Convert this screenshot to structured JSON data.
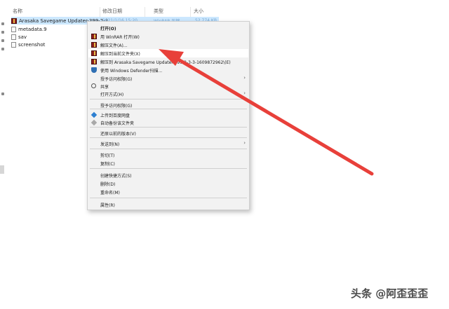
{
  "explorer": {
    "columns": [
      "名称",
      "修改日期",
      "类型",
      "大小"
    ],
    "files": [
      {
        "name": "Arasaka Savegame Updater-399-2-3",
        "date": "2021/1/16 15:20",
        "type": "WinRAR 压缩",
        "size": "52,774 KB",
        "selected": true,
        "icon": "archive-icon"
      },
      {
        "name": "metadata.9",
        "icon": "file-icon"
      },
      {
        "name": "sav",
        "icon": "file-icon"
      },
      {
        "name": "screenshot",
        "icon": "file-icon"
      }
    ]
  },
  "context_menu": {
    "items": [
      {
        "label": "打开(O)",
        "bold": true,
        "icon": "none"
      },
      {
        "label": "用 WinRAR 打开(W)",
        "icon": "winrar-icon"
      },
      {
        "label": "解压文件(A)...",
        "icon": "winrar-icon"
      },
      {
        "label": "解压到当前文件夹(X)",
        "icon": "winrar-icon",
        "highlighted": true
      },
      {
        "label": "解压到 Arasaka Savegame Updater-399-2-3-3-1609872962\\(E)",
        "icon": "winrar-icon"
      },
      {
        "label": "使用 Windows Defender扫描...",
        "icon": "defender-shield-icon"
      },
      {
        "label": "授予访问权限(G)",
        "icon": "none",
        "submenu": true
      },
      {
        "label": "共享",
        "icon": "share-icon"
      },
      {
        "label": "打开方式(H)",
        "icon": "none",
        "submenu": true
      },
      {
        "label": "授予访问权限(G)",
        "icon": "none",
        "separator_before": true
      },
      {
        "label": "上传到百度网盘",
        "icon": "baidu-blue-icon",
        "separator_before": true
      },
      {
        "label": "自动备份该文件夹",
        "icon": "baidu-gray-icon"
      },
      {
        "label": "还原以前的版本(V)",
        "icon": "none",
        "separator_before": true
      },
      {
        "label": "发送到(N)",
        "icon": "none",
        "submenu": true,
        "separator_before": true
      },
      {
        "label": "剪切(T)",
        "icon": "none",
        "separator_before": true
      },
      {
        "label": "复制(C)",
        "icon": "none"
      },
      {
        "label": "创建快捷方式(S)",
        "icon": "none",
        "separator_before": true
      },
      {
        "label": "删除(D)",
        "icon": "none"
      },
      {
        "label": "重命名(M)",
        "icon": "none"
      },
      {
        "label": "属性(R)",
        "icon": "none",
        "separator_before": true
      }
    ]
  },
  "annotation": {
    "arrow_color": "#e8403a"
  },
  "watermark": "头条 @阿歪歪歪"
}
